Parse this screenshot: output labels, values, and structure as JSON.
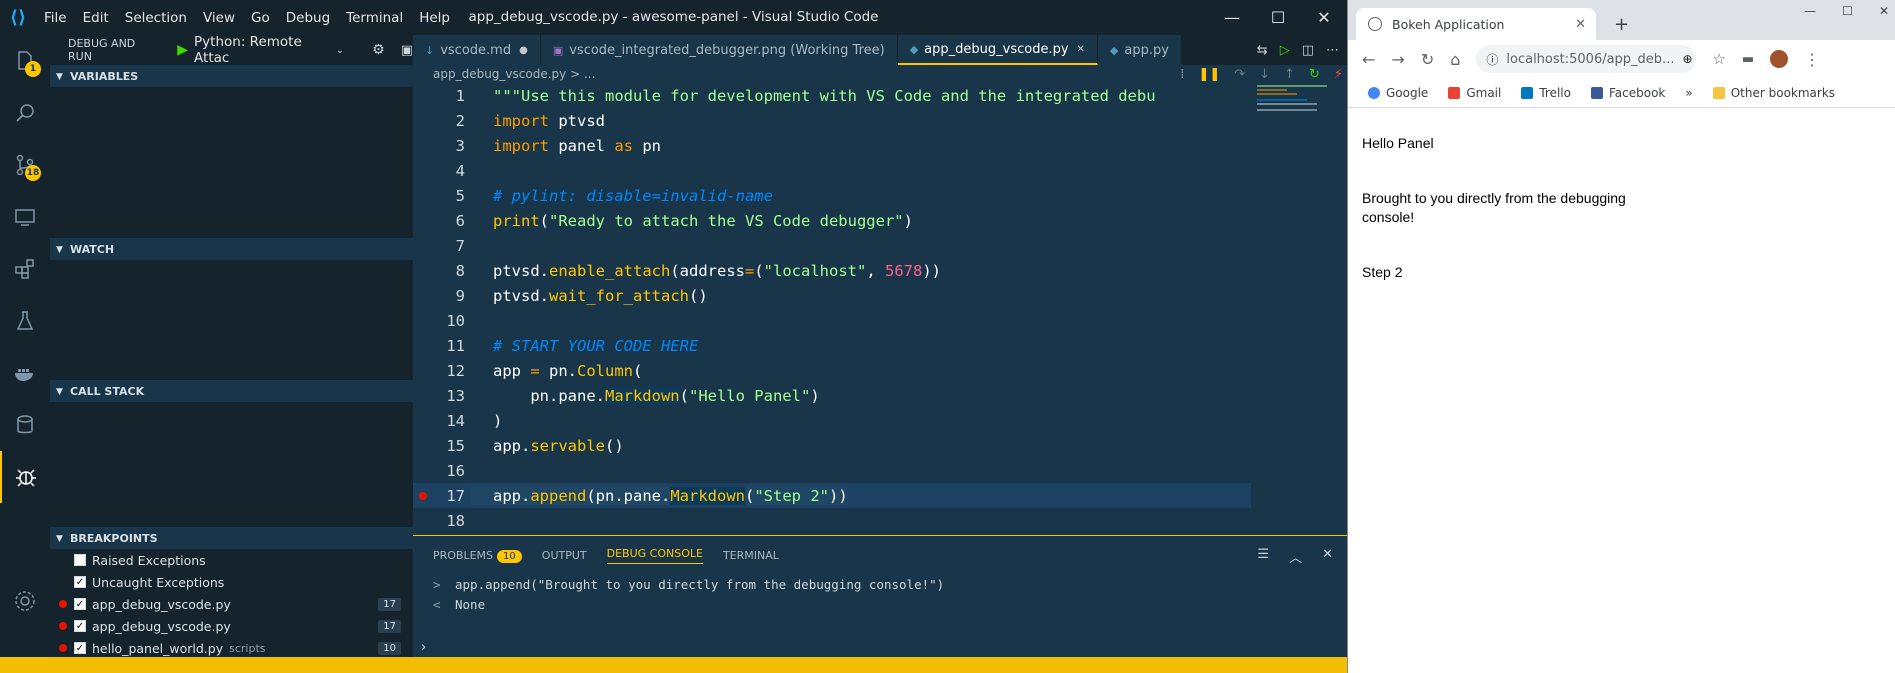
{
  "window": {
    "title": "app_debug_vscode.py - awesome-panel - Visual Studio Code",
    "menu": [
      "File",
      "Edit",
      "Selection",
      "View",
      "Go",
      "Debug",
      "Terminal",
      "Help"
    ]
  },
  "activity": {
    "explorer_badge": "1",
    "scm_badge": "18"
  },
  "sidebar": {
    "header": "DEBUG AND RUN",
    "config": "Python: Remote Attac",
    "variables": "VARIABLES",
    "watch": "WATCH",
    "callstack": "CALL STACK",
    "breakpoints": "BREAKPOINTS",
    "bp_items": [
      {
        "label": "Raised Exceptions",
        "checked": false,
        "count": "",
        "sub": ""
      },
      {
        "label": "Uncaught Exceptions",
        "checked": true,
        "count": "",
        "sub": ""
      },
      {
        "label": "app_debug_vscode.py",
        "checked": true,
        "count": "17",
        "sub": ""
      },
      {
        "label": "app_debug_vscode.py",
        "checked": true,
        "count": "17",
        "sub": ""
      },
      {
        "label": "hello_panel_world.py",
        "checked": true,
        "count": "10",
        "sub": "scripts"
      }
    ]
  },
  "tabs": [
    {
      "label": "vscode.md",
      "modified": true
    },
    {
      "label": "vscode_integrated_debugger.png (Working Tree)",
      "modified": false
    },
    {
      "label": "app_debug_vscode.py",
      "modified": false
    },
    {
      "label": "app.py",
      "modified": false
    }
  ],
  "breadcrumb": "app_debug_vscode.py > ...",
  "code": [
    "\"\"\"Use this module for development with VS Code and the integrated debu",
    "import ptvsd",
    "import panel as pn",
    "",
    "# pylint: disable=invalid-name",
    "print(\"Ready to attach the VS Code debugger\")",
    "",
    "ptvsd.enable_attach(address=(\"localhost\", 5678))",
    "ptvsd.wait_for_attach()",
    "",
    "# START YOUR CODE HERE",
    "app = pn.Column(",
    "    pn.pane.Markdown(\"Hello Panel\")",
    ")",
    "app.servable()",
    "",
    "app.append(pn.pane.Markdown(\"Step 2\"))",
    ""
  ],
  "panel": {
    "tabs": [
      "PROBLEMS",
      "OUTPUT",
      "DEBUG CONSOLE",
      "TERMINAL"
    ],
    "problems_count": "10",
    "console": [
      {
        "prefix": ">",
        "text": "app.append(\"Brought to you directly from the debugging console!\")"
      },
      {
        "prefix": "<",
        "text": "None"
      }
    ]
  },
  "browser": {
    "tab_title": "Bokeh Application",
    "url": "localhost:5006/app_deb...",
    "bookmarks": [
      "Google",
      "Gmail",
      "Trello",
      "Facebook"
    ],
    "other_bookmarks": "Other bookmarks",
    "content": [
      "Hello Panel",
      "Brought to you directly from the debugging console!",
      "Step 2"
    ]
  }
}
